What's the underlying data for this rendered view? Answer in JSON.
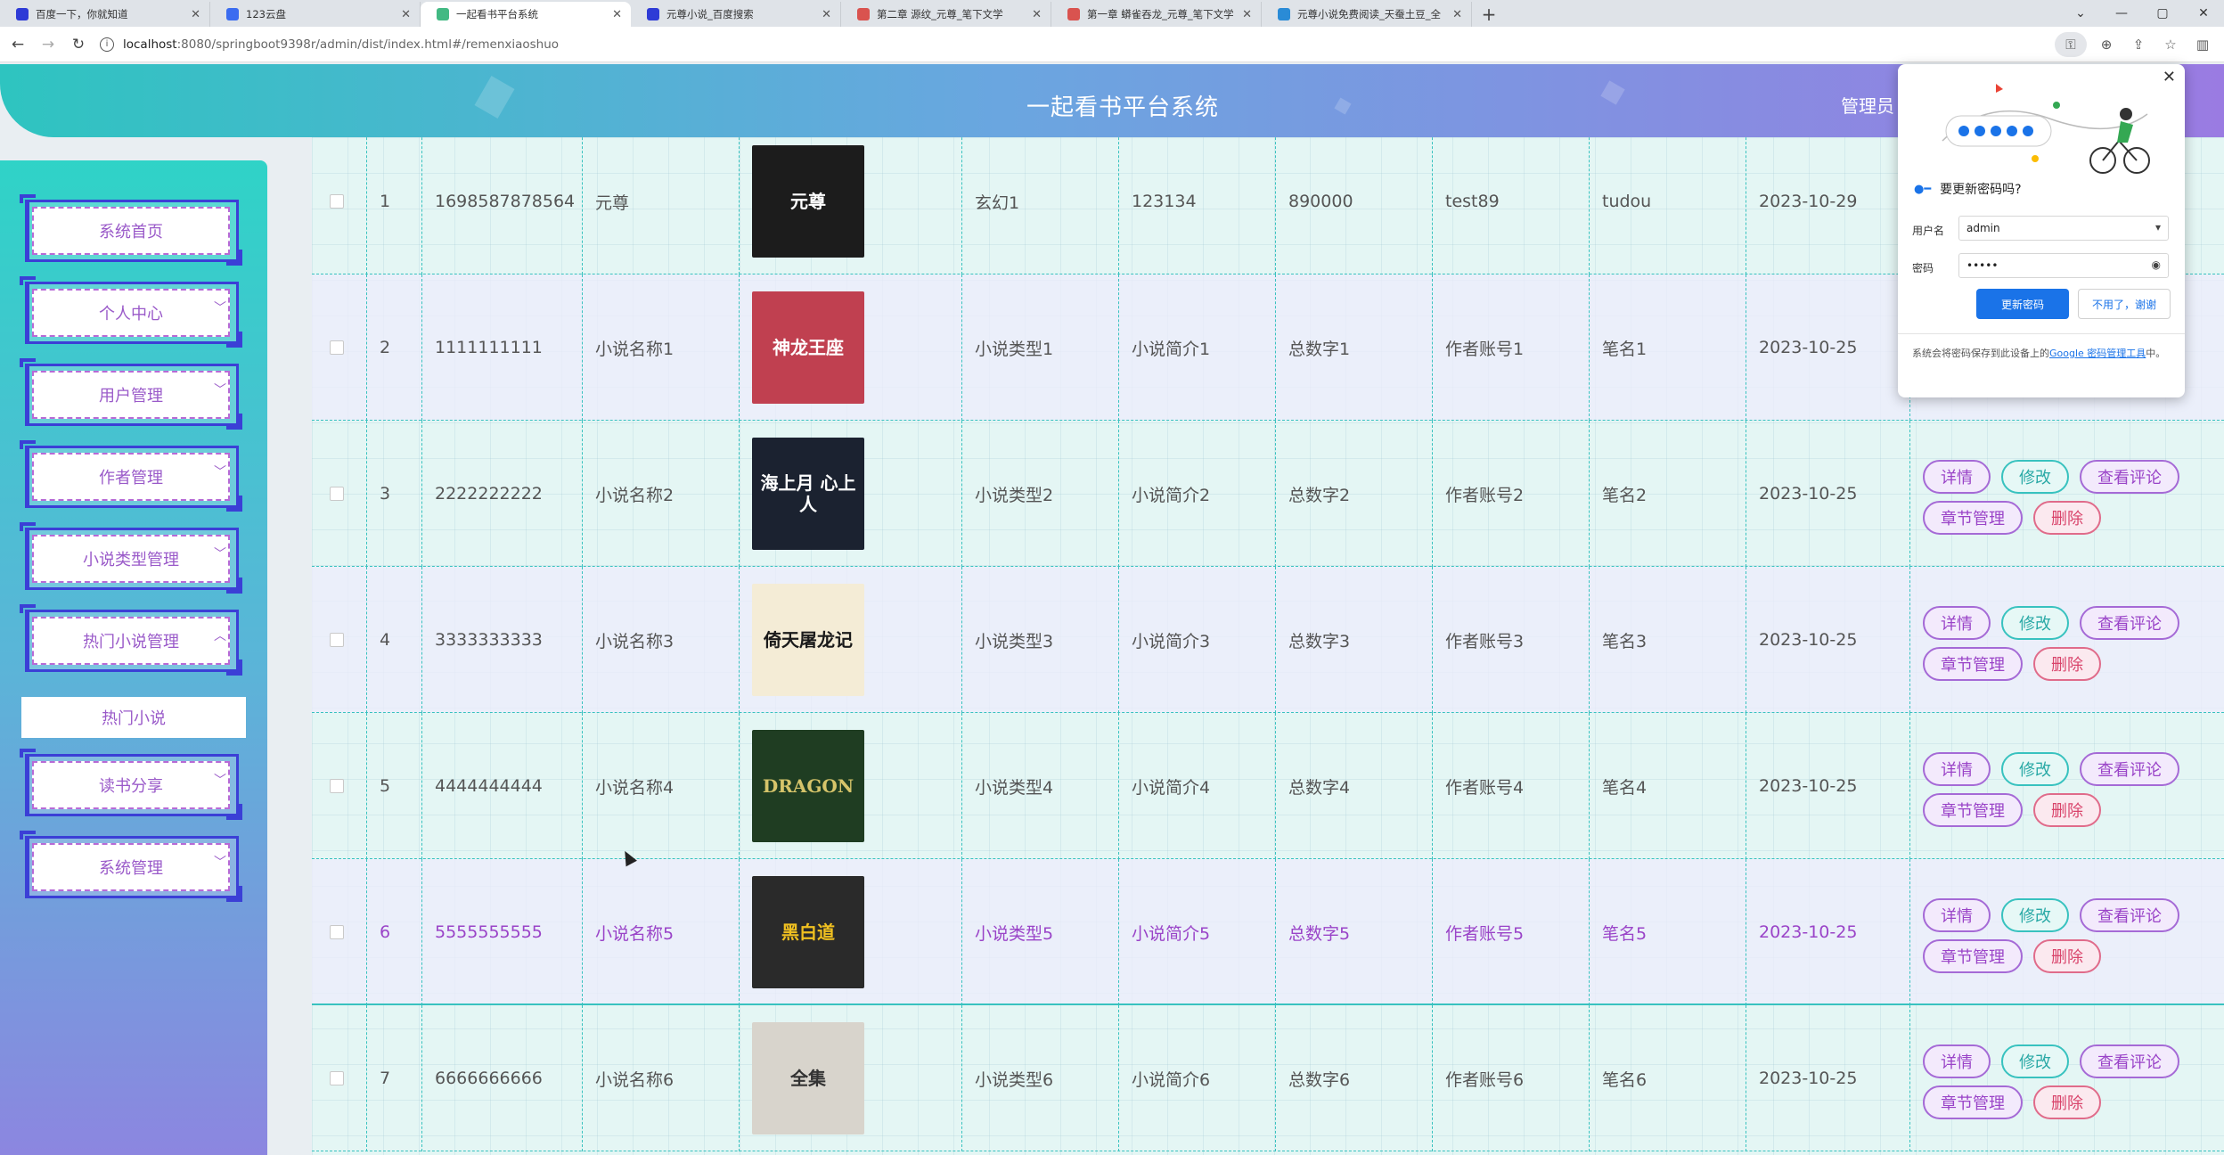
{
  "browser": {
    "tabs": [
      {
        "label": "百度一下，你就知道",
        "fav_color": "#2e3bd6"
      },
      {
        "label": "123云盘",
        "fav_color": "#3b6cf0"
      },
      {
        "label": "一起看书平台系统",
        "fav_color": "#42b983"
      },
      {
        "label": "元尊小说_百度搜索",
        "fav_color": "#2e3bd6"
      },
      {
        "label": "第二章 源纹_元尊_笔下文学",
        "fav_color": "#d9534f"
      },
      {
        "label": "第一章 蟒雀吞龙_元尊_笔下文学",
        "fav_color": "#d9534f"
      },
      {
        "label": "元尊小说免费阅读_天蚕土豆_全",
        "fav_color": "#2a8bd6"
      }
    ],
    "url_host": "localhost",
    "url_path": ":8080/springboot9398r/admin/dist/index.html#/remenxiaoshuo"
  },
  "header": {
    "title": "一起看书平台系统",
    "user": "管理员"
  },
  "sidebar": {
    "items": [
      {
        "label": "系统首页",
        "chevron": ""
      },
      {
        "label": "个人中心",
        "chevron": "﹀"
      },
      {
        "label": "用户管理",
        "chevron": "﹀"
      },
      {
        "label": "作者管理",
        "chevron": "﹀"
      },
      {
        "label": "小说类型管理",
        "chevron": "﹀"
      },
      {
        "label": "热门小说管理",
        "chevron": "︿"
      },
      {
        "label": "读书分享",
        "chevron": "﹀"
      },
      {
        "label": "系统管理",
        "chevron": "﹀"
      }
    ],
    "submenu_active": "热门小说"
  },
  "actions": {
    "detail": "详情",
    "edit": "修改",
    "review": "查看评论",
    "chapter": "章节管理",
    "delete": "删除"
  },
  "rows": [
    {
      "idx": "1",
      "code": "1698587878564",
      "name": "元尊",
      "type": "玄幻1",
      "intro": "123134",
      "words": "890000",
      "account": "test89",
      "pen": "tudou",
      "date": "2023-10-29",
      "cover_bg": "#1c1c1c",
      "cover_fg": "#ffffff",
      "cover_text": "元尊"
    },
    {
      "idx": "2",
      "code": "1111111111",
      "name": "小说名称1",
      "type": "小说类型1",
      "intro": "小说简介1",
      "words": "总数字1",
      "account": "作者账号1",
      "pen": "笔名1",
      "date": "2023-10-25",
      "cover_bg": "#c04050",
      "cover_fg": "#ffffff",
      "cover_text": "神龙王座"
    },
    {
      "idx": "3",
      "code": "2222222222",
      "name": "小说名称2",
      "type": "小说类型2",
      "intro": "小说简介2",
      "words": "总数字2",
      "account": "作者账号2",
      "pen": "笔名2",
      "date": "2023-10-25",
      "cover_bg": "#1b2230",
      "cover_fg": "#ffffff",
      "cover_text": "海上月 心上人"
    },
    {
      "idx": "4",
      "code": "3333333333",
      "name": "小说名称3",
      "type": "小说类型3",
      "intro": "小说简介3",
      "words": "总数字3",
      "account": "作者账号3",
      "pen": "笔名3",
      "date": "2023-10-25",
      "cover_bg": "#f4ecd6",
      "cover_fg": "#1a1a1a",
      "cover_text": "倚天屠龙记"
    },
    {
      "idx": "5",
      "code": "4444444444",
      "name": "小说名称4",
      "type": "小说类型4",
      "intro": "小说简介4",
      "words": "总数字4",
      "account": "作者账号4",
      "pen": "笔名4",
      "date": "2023-10-25",
      "cover_bg": "#1f3d22",
      "cover_fg": "#d6c46a",
      "cover_text": "DRAGON"
    },
    {
      "idx": "6",
      "code": "5555555555",
      "name": "小说名称5",
      "type": "小说类型5",
      "intro": "小说简介5",
      "words": "总数字5",
      "account": "作者账号5",
      "pen": "笔名5",
      "date": "2023-10-25",
      "cover_bg": "#2a2a2a",
      "cover_fg": "#f0c020",
      "cover_text": "黑白道"
    },
    {
      "idx": "7",
      "code": "6666666666",
      "name": "小说名称6",
      "type": "小说类型6",
      "intro": "小说简介6",
      "words": "总数字6",
      "account": "作者账号6",
      "pen": "笔名6",
      "date": "2023-10-25",
      "cover_bg": "#d8d4cc",
      "cover_fg": "#333333",
      "cover_text": "全集"
    }
  ],
  "password_popup": {
    "title": "要更新密码吗?",
    "username_label": "用户名",
    "username_value": "admin",
    "password_label": "密码",
    "password_value": "•••••",
    "update_button": "更新密码",
    "no_thanks_button": "不用了，谢谢",
    "footer_text": "系统会将密码保存到此设备上的",
    "footer_link": "Google 密码管理工具",
    "footer_end": "中。"
  }
}
